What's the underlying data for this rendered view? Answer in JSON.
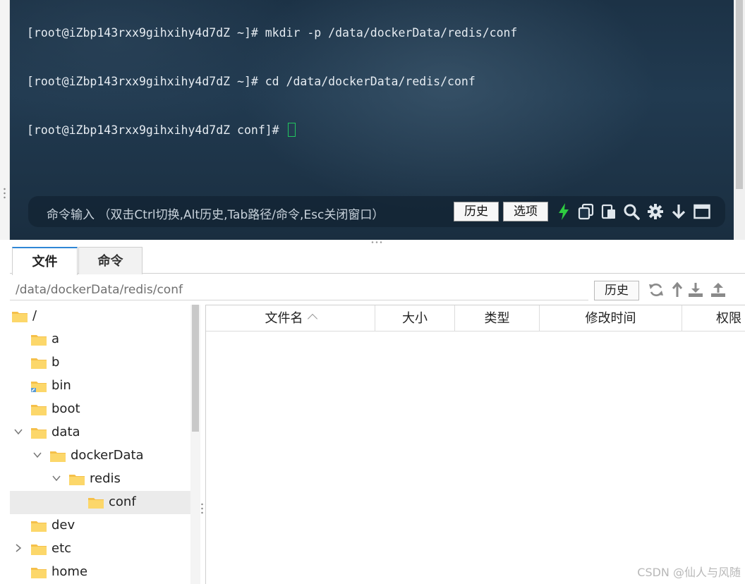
{
  "terminal": {
    "lines": [
      "[root@iZbp143rxx9gihxihy4d7dZ ~]# mkdir -p /data/dockerData/redis/conf",
      "[root@iZbp143rxx9gihxihy4d7dZ ~]# cd /data/dockerData/redis/conf",
      "[root@iZbp143rxx9gihxihy4d7dZ conf]# "
    ],
    "cursor_color": "#22c55e"
  },
  "command_bar": {
    "placeholder": "命令输入 （双击Ctrl切换,Alt历史,Tab路径/命令,Esc关闭窗口）",
    "history_label": "历史",
    "options_label": "选项",
    "icons": [
      "lightning-icon",
      "copy-icon",
      "paste-icon",
      "search-icon",
      "gear-icon",
      "download-arrow-icon",
      "window-icon"
    ],
    "lightning_color": "#2ecc40"
  },
  "tabs": [
    {
      "label": "文件",
      "active": true
    },
    {
      "label": "命令",
      "active": false
    }
  ],
  "path_bar": {
    "path": "/data/dockerData/redis/conf",
    "history_label": "历史",
    "icons": [
      "refresh-icon",
      "up-arrow-icon",
      "download-icon",
      "upload-icon"
    ]
  },
  "tree": [
    {
      "label": "/",
      "depth": 0,
      "expander": "",
      "selected": false
    },
    {
      "label": "a",
      "depth": 1,
      "expander": "",
      "selected": false
    },
    {
      "label": "b",
      "depth": 1,
      "expander": "",
      "selected": false
    },
    {
      "label": "bin",
      "depth": 1,
      "expander": "",
      "selected": false,
      "link": true
    },
    {
      "label": "boot",
      "depth": 1,
      "expander": "",
      "selected": false
    },
    {
      "label": "data",
      "depth": 1,
      "expander": "expanded",
      "selected": false
    },
    {
      "label": "dockerData",
      "depth": 2,
      "expander": "expanded",
      "selected": false
    },
    {
      "label": "redis",
      "depth": 3,
      "expander": "expanded",
      "selected": false
    },
    {
      "label": "conf",
      "depth": 4,
      "expander": "",
      "selected": true
    },
    {
      "label": "dev",
      "depth": 1,
      "expander": "",
      "selected": false
    },
    {
      "label": "etc",
      "depth": 1,
      "expander": "collapsed",
      "selected": false
    },
    {
      "label": "home",
      "depth": 1,
      "expander": "",
      "selected": false
    }
  ],
  "file_table": {
    "columns": [
      "文件名",
      "大小",
      "类型",
      "修改时间",
      "权限"
    ],
    "sort_column": "文件名",
    "rows": []
  },
  "watermark": "CSDN @仙人与风随",
  "colors": {
    "tab_accent": "#2f86d6",
    "folder": "#f5c04a"
  }
}
